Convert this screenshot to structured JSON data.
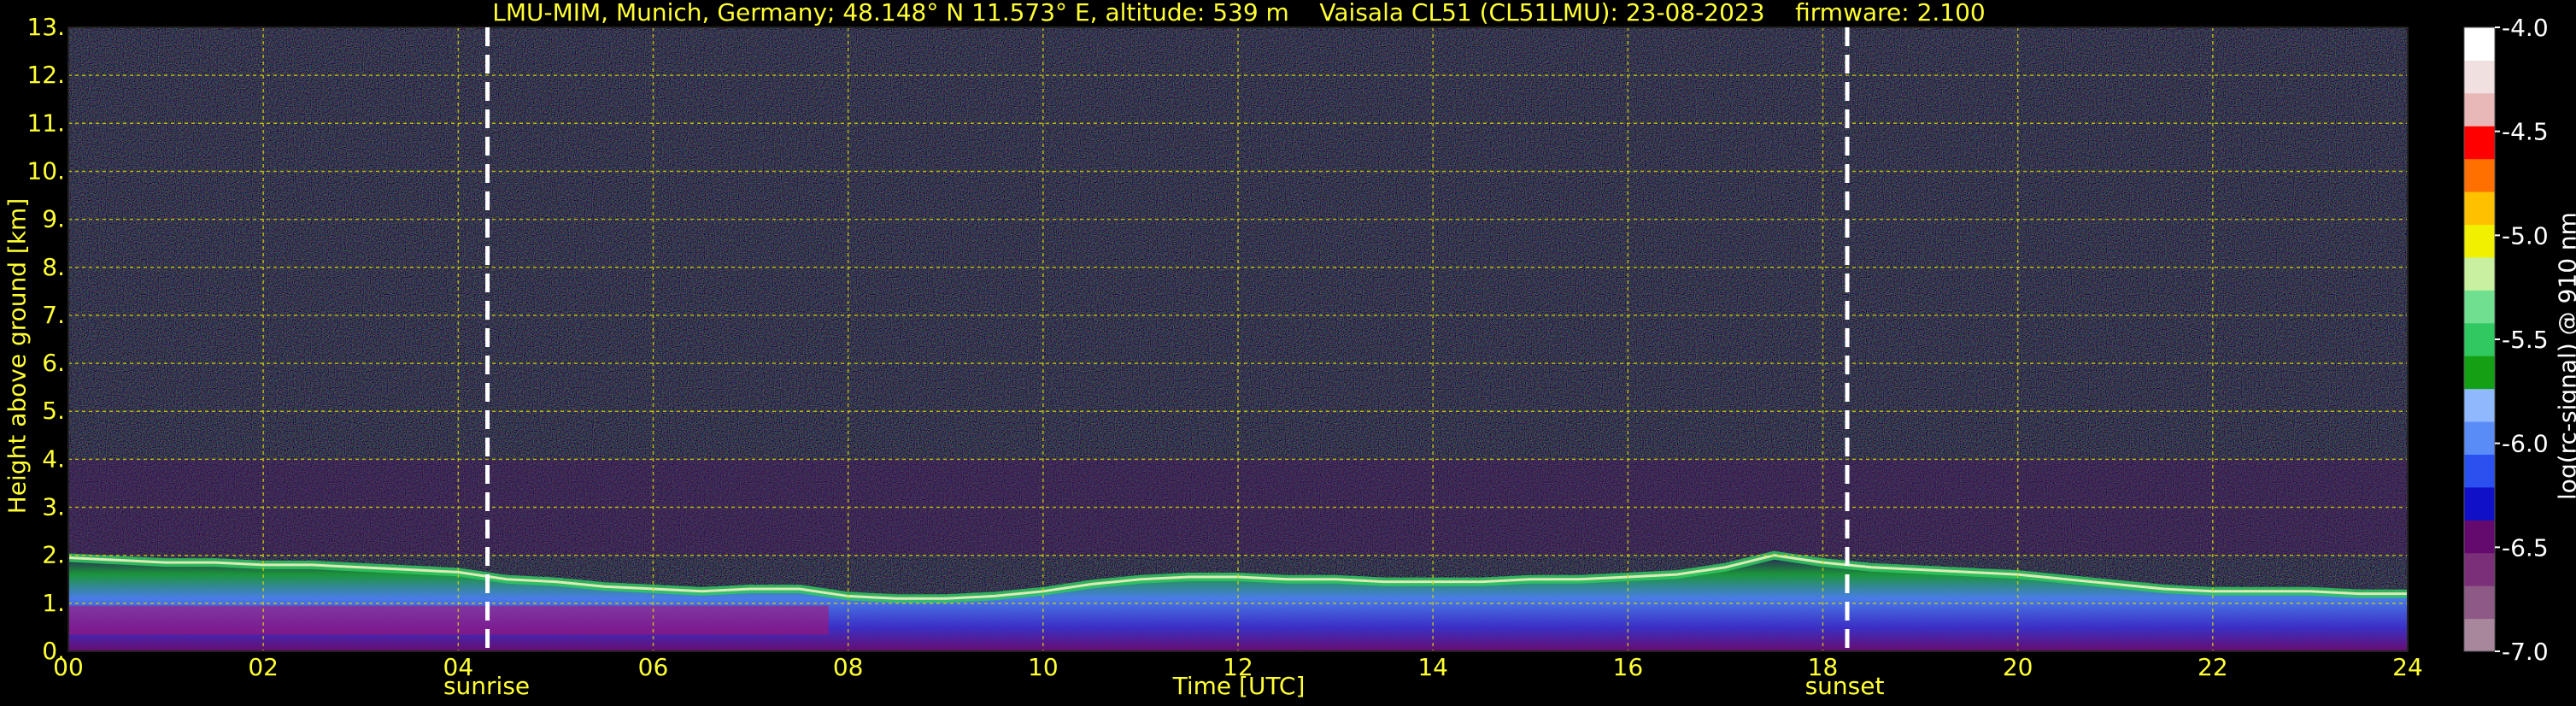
{
  "title": "LMU-MIM, Munich, Germany; 48.148° N 11.573° E, altitude: 539 m    Vaisala CL51 (CL51LMU): 23-08-2023    firmware: 2.100",
  "chart_data": {
    "type": "heatmap",
    "xlabel": "Time [UTC]",
    "ylabel": "Height above ground [km]",
    "xlim": [
      0,
      24
    ],
    "ylim": [
      0,
      13
    ],
    "x_ticks": [
      "00",
      "02",
      "04",
      "06",
      "08",
      "10",
      "12",
      "14",
      "16",
      "18",
      "20",
      "22",
      "24"
    ],
    "y_ticks": [
      "0.",
      "1.",
      "2.",
      "3.",
      "4.",
      "5.",
      "6.",
      "7.",
      "8.",
      "9.",
      "10.",
      "11.",
      "12.",
      "13."
    ],
    "grid": true,
    "markers": [
      {
        "label": "sunrise",
        "x": 4.3
      },
      {
        "label": "sunset",
        "x": 18.25
      }
    ],
    "colorbar": {
      "label": "log(rc-signal) @ 910 nm",
      "range": [
        -7.0,
        -4.0
      ],
      "ticks": [
        "-4.0",
        "-4.5",
        "-5.0",
        "-5.5",
        "-6.0",
        "-6.5",
        "-7.0"
      ],
      "colors": [
        "#a8879c",
        "#8c5a84",
        "#7a2f78",
        "#640a6e",
        "#1010c8",
        "#2a50f0",
        "#5a8cf8",
        "#90b8fc",
        "#14a014",
        "#30c860",
        "#70e090",
        "#c8f0a0",
        "#f0f000",
        "#ffc000",
        "#ff7000",
        "#ff0000",
        "#e8b8b8",
        "#f0e0e0",
        "#ffffff"
      ]
    },
    "boundary_layer_top_km": [
      [
        0.0,
        1.95
      ],
      [
        0.5,
        1.9
      ],
      [
        1.0,
        1.85
      ],
      [
        1.5,
        1.85
      ],
      [
        2.0,
        1.8
      ],
      [
        2.5,
        1.8
      ],
      [
        3.0,
        1.75
      ],
      [
        3.5,
        1.7
      ],
      [
        4.0,
        1.65
      ],
      [
        4.5,
        1.5
      ],
      [
        5.0,
        1.45
      ],
      [
        5.5,
        1.35
      ],
      [
        6.0,
        1.3
      ],
      [
        6.5,
        1.25
      ],
      [
        7.0,
        1.3
      ],
      [
        7.5,
        1.3
      ],
      [
        8.0,
        1.15
      ],
      [
        8.5,
        1.1
      ],
      [
        9.0,
        1.1
      ],
      [
        9.5,
        1.15
      ],
      [
        10.0,
        1.25
      ],
      [
        10.5,
        1.4
      ],
      [
        11.0,
        1.5
      ],
      [
        11.5,
        1.55
      ],
      [
        12.0,
        1.55
      ],
      [
        12.5,
        1.5
      ],
      [
        13.0,
        1.5
      ],
      [
        13.5,
        1.45
      ],
      [
        14.0,
        1.45
      ],
      [
        14.5,
        1.45
      ],
      [
        15.0,
        1.5
      ],
      [
        15.5,
        1.5
      ],
      [
        16.0,
        1.55
      ],
      [
        16.5,
        1.6
      ],
      [
        17.0,
        1.75
      ],
      [
        17.5,
        2.0
      ],
      [
        18.0,
        1.85
      ],
      [
        18.5,
        1.75
      ],
      [
        19.0,
        1.7
      ],
      [
        19.5,
        1.65
      ],
      [
        20.0,
        1.6
      ],
      [
        20.5,
        1.5
      ],
      [
        21.0,
        1.4
      ],
      [
        21.5,
        1.3
      ],
      [
        22.0,
        1.25
      ],
      [
        22.5,
        1.25
      ],
      [
        23.0,
        1.25
      ],
      [
        23.5,
        1.2
      ],
      [
        24.0,
        1.2
      ]
    ]
  }
}
